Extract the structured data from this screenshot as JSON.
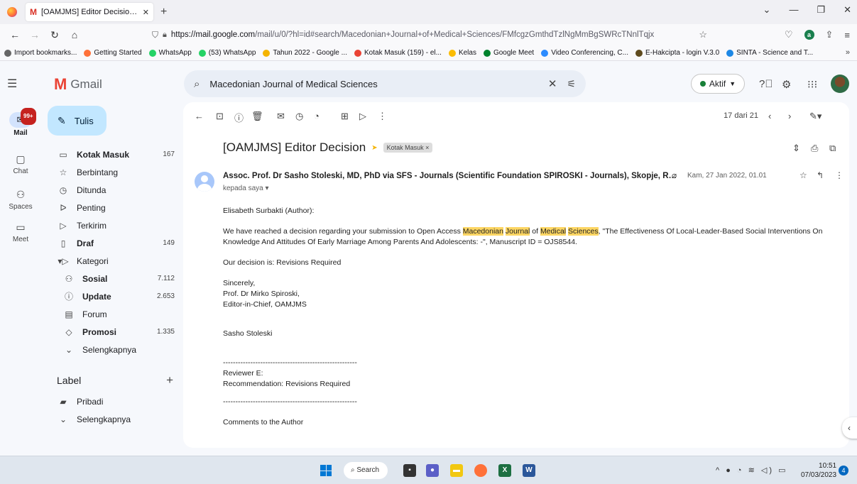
{
  "browser": {
    "tab_title": "[OAMJMS] Editor Decision - elis",
    "url_host": "https://mail.google.com",
    "url_path": "/mail/u/0/?hl=id#search/Macedonian+Journal+of+Medical+Sciences/FMfcgzGmthdTzlNgMmBgSWRcTNnlTqjx",
    "bookmarks": [
      {
        "label": "Import bookmarks...",
        "color": "#666666"
      },
      {
        "label": "Getting Started",
        "color": "#ff7139"
      },
      {
        "label": "WhatsApp",
        "color": "#25d366"
      },
      {
        "label": "(53) WhatsApp",
        "color": "#25d366"
      },
      {
        "label": "Tahun 2022 - Google ...",
        "color": "#f4b400"
      },
      {
        "label": "Kotak Masuk (159) - el...",
        "color": "#ea4335"
      },
      {
        "label": "Kelas",
        "color": "#fbbc04"
      },
      {
        "label": "Google Meet",
        "color": "#00832d"
      },
      {
        "label": "Video Conferencing, C...",
        "color": "#2d8cff"
      },
      {
        "label": "E-Hakcipta - login V.3.0",
        "color": "#5f4b1e"
      },
      {
        "label": "SINTA - Science and T...",
        "color": "#1e88e5"
      }
    ]
  },
  "rail": {
    "badge": "99+",
    "items": [
      "Mail",
      "Chat",
      "Spaces",
      "Meet"
    ]
  },
  "header": {
    "brand": "Gmail",
    "search_value": "Macedonian Journal of Medical Sciences",
    "status": "Aktif"
  },
  "compose_label": "Tulis",
  "nav": {
    "items": [
      {
        "label": "Kotak Masuk",
        "count": "167",
        "icon": "inbox-icon",
        "glyph": "▭",
        "bold": true,
        "sub": false
      },
      {
        "label": "Berbintang",
        "count": "",
        "icon": "star-icon",
        "glyph": "☆",
        "bold": false,
        "sub": false
      },
      {
        "label": "Ditunda",
        "count": "",
        "icon": "clock-icon",
        "glyph": "◷",
        "bold": false,
        "sub": false
      },
      {
        "label": "Penting",
        "count": "",
        "icon": "important-icon",
        "glyph": "ᐅ",
        "bold": false,
        "sub": false
      },
      {
        "label": "Terkirim",
        "count": "",
        "icon": "send-icon",
        "glyph": "▷",
        "bold": false,
        "sub": false
      },
      {
        "label": "Draf",
        "count": "149",
        "icon": "draft-icon",
        "glyph": "▯",
        "bold": true,
        "sub": false
      },
      {
        "label": "Kategori",
        "count": "",
        "icon": "label-icon",
        "glyph": "▾▷",
        "bold": false,
        "sub": false
      },
      {
        "label": "Sosial",
        "count": "7.112",
        "icon": "people-icon",
        "glyph": "⚇",
        "bold": true,
        "sub": true
      },
      {
        "label": "Update",
        "count": "2.653",
        "icon": "info-icon",
        "glyph": "ⓘ",
        "bold": true,
        "sub": true
      },
      {
        "label": "Forum",
        "count": "",
        "icon": "forum-icon",
        "glyph": "▤",
        "bold": false,
        "sub": true
      },
      {
        "label": "Promosi",
        "count": "1.335",
        "icon": "tag-icon",
        "glyph": "◇",
        "bold": true,
        "sub": true
      },
      {
        "label": "Selengkapnya",
        "count": "",
        "icon": "chevron-down-icon",
        "glyph": "⌄",
        "bold": false,
        "sub": true
      }
    ],
    "label_heading": "Label",
    "labels": [
      {
        "label": "Pribadi",
        "icon": "label-filled-icon",
        "glyph": "▰"
      },
      {
        "label": "Selengkapnya",
        "icon": "chevron-down-icon",
        "glyph": "⌄"
      }
    ]
  },
  "toolbar": {
    "pager": "17 dari 21"
  },
  "email": {
    "subject": "[OAMJMS] Editor Decision",
    "label_chip": "Kotak Masuk ×",
    "sender": "Assoc. Prof. Dr Sasho Stoleski, MD, PhD via SFS - Journals (Scientific Foundation SPIROSKI - Journals), Skopje, Republi...",
    "to": "kepada saya ▾",
    "date": "Kam, 27 Jan 2022, 01.01",
    "greeting": "Elisabeth Surbakti (Author):",
    "p1_before": "We have reached a decision regarding your submission to Open Access ",
    "hl1": "Macedonian",
    "hl2": "Journal",
    "p1_of": " of ",
    "hl3": "Medical",
    "hl4": "Sciences",
    "p1_after": ", \"The Effectiveness Of Local-Leader-Based Social Interventions On Knowledge And Attitudes Of Early Marriage Among Parents And Adolescents: -\", Manuscript ID = OJS8544.",
    "decision": "Our decision is: Revisions Required",
    "sincerely": "Sincerely,",
    "sig_name": "Prof. Dr Mirko Spiroski,",
    "sig_title": "Editor-in-Chief, OAMJMS",
    "sender_name": "Sasho Stoleski",
    "dashes": "------------------------------------------------------",
    "reviewer": "Reviewer E:",
    "recommendation": "Recommendation: Revisions Required",
    "comments": "Comments to the Author"
  },
  "taskbar": {
    "search": "Search",
    "time": "10:51",
    "date": "07/03/2023",
    "notifications": "4"
  }
}
